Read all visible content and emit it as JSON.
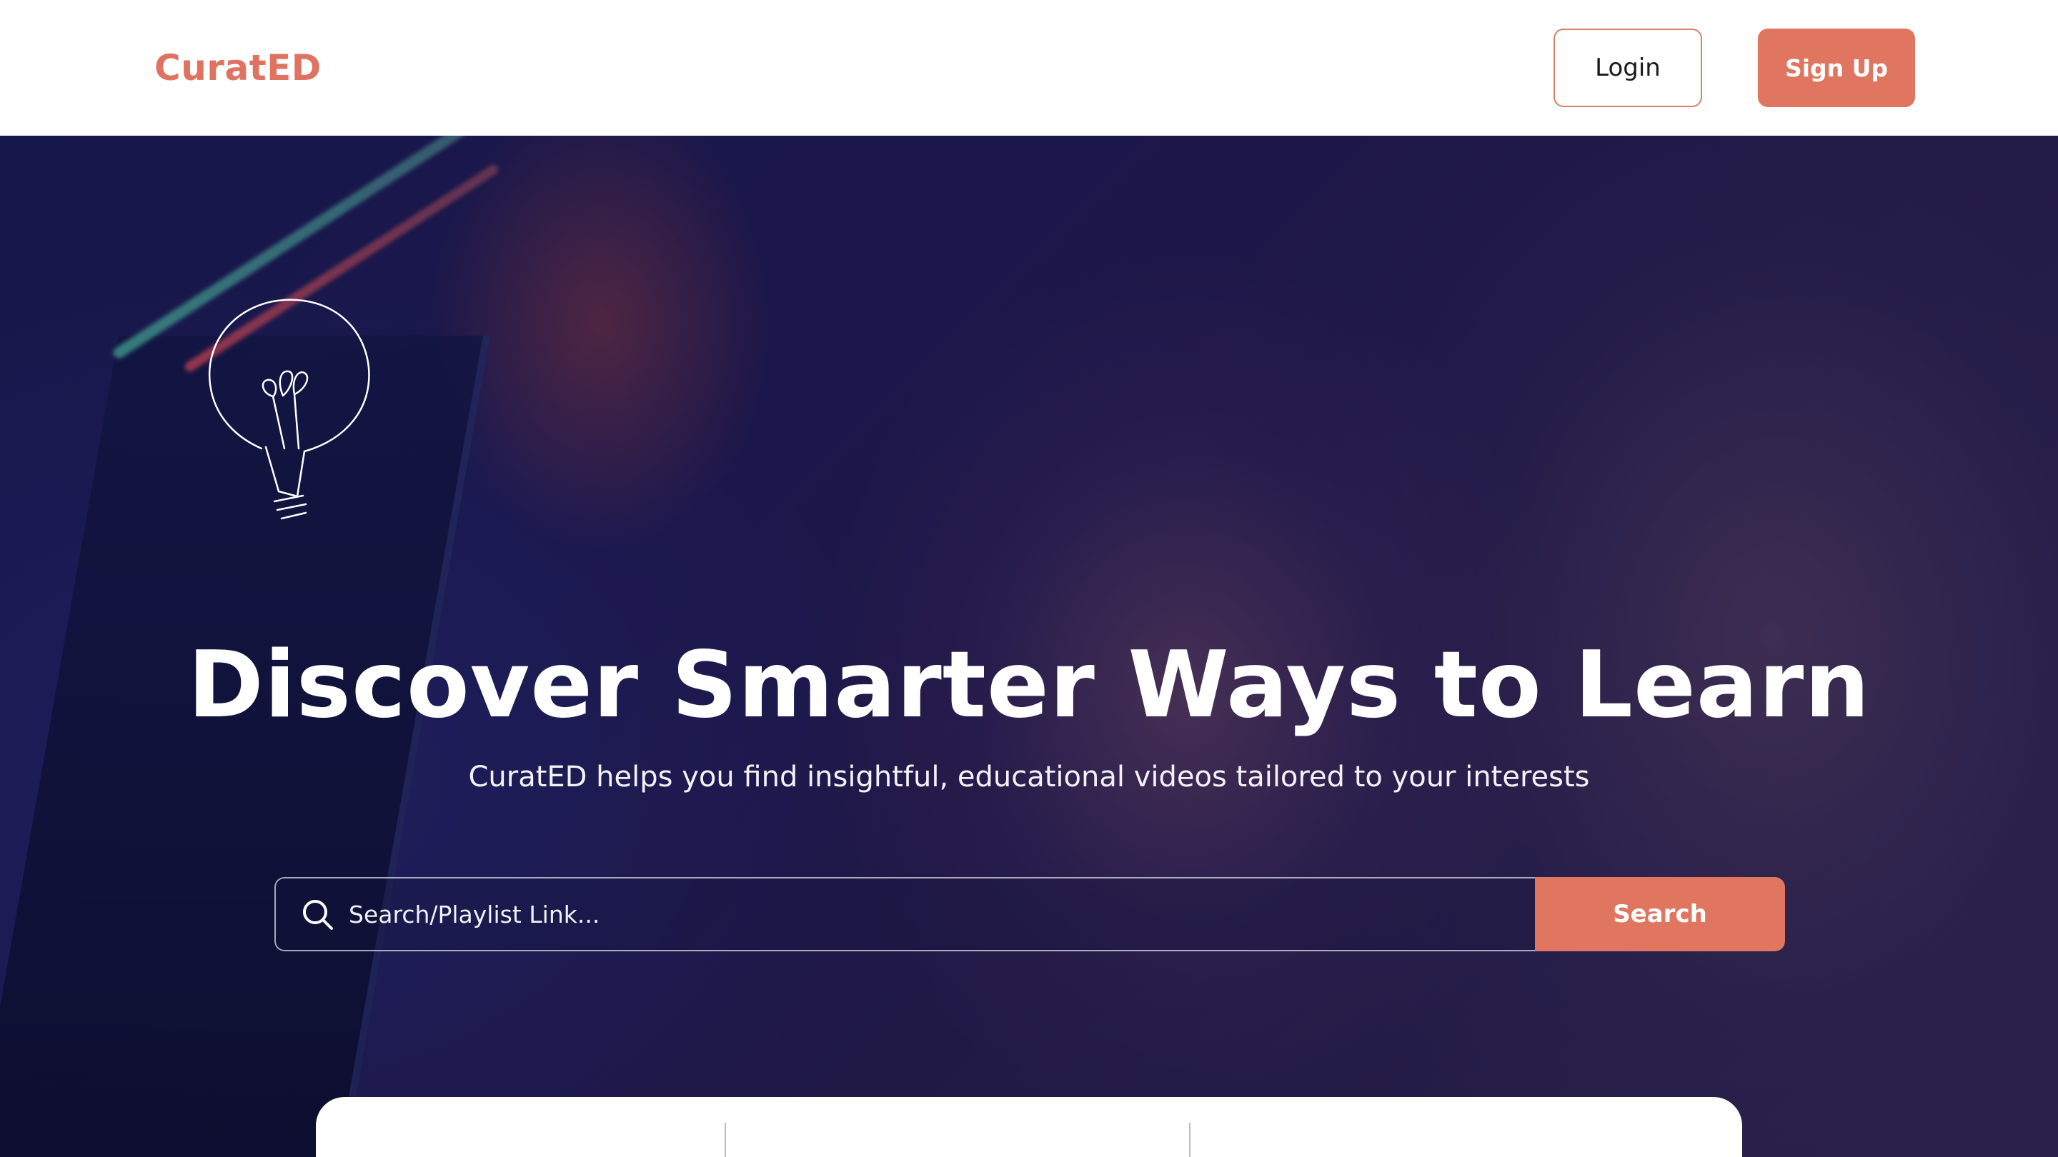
{
  "header": {
    "brand": "CuratED",
    "login_label": "Login",
    "signup_label": "Sign Up"
  },
  "hero": {
    "title": "Discover Smarter Ways to Learn",
    "subtitle": "CuratED helps you find insightful,  educational videos tailored to your interests",
    "decoration_icon": "lightbulb-icon"
  },
  "search": {
    "placeholder": "Search/Playlist Link...",
    "value": "",
    "button_label": "Search",
    "icon": "search-icon"
  },
  "colors": {
    "accent": "#e07560",
    "brand_text": "#df7260",
    "hero_overlay": "#1b1d57",
    "white": "#ffffff"
  }
}
